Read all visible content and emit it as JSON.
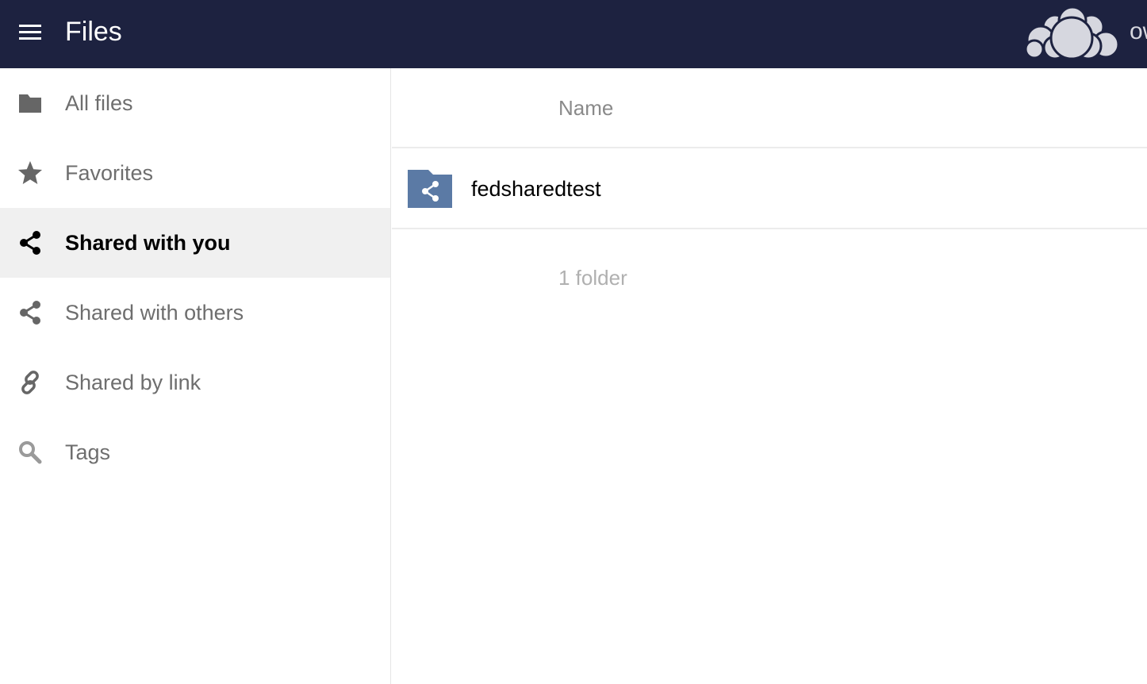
{
  "header": {
    "menu_icon": "hamburger-menu-icon",
    "title": "Files",
    "logo_icon": "owncloud-cloud-logo",
    "logo_text": "ownCloud",
    "background_color": "#1d2240"
  },
  "sidebar": {
    "items": [
      {
        "label": "All files",
        "icon": "folder-icon",
        "active": false
      },
      {
        "label": "Favorites",
        "icon": "star-icon",
        "active": false
      },
      {
        "label": "Shared with you",
        "icon": "share-icon",
        "active": true
      },
      {
        "label": "Shared with others",
        "icon": "share-icon",
        "active": false
      },
      {
        "label": "Shared by link",
        "icon": "link-icon",
        "active": false
      },
      {
        "label": "Tags",
        "icon": "search-icon",
        "active": false
      }
    ]
  },
  "main": {
    "column_header": {
      "name": "Name"
    },
    "files": [
      {
        "name": "fedsharedtest",
        "icon": "shared-folder-icon",
        "icon_color": "#5b7aa5"
      }
    ],
    "summary": "1 folder"
  }
}
